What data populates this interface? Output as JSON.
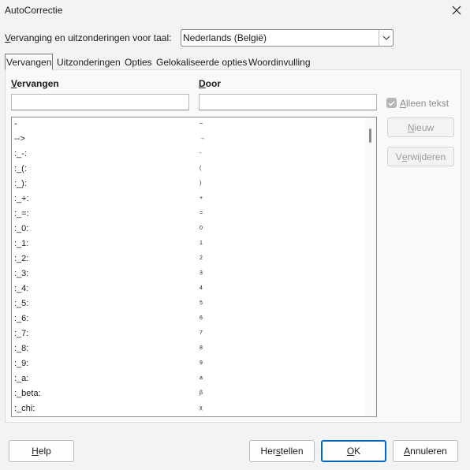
{
  "window": {
    "title": "AutoCorrectie"
  },
  "language": {
    "label_pre": "V",
    "label_rest": "ervanging en uitzonderingen voor taal:",
    "value": "Nederlands (België)"
  },
  "tabs": [
    {
      "label": "Vervangen",
      "active": true
    },
    {
      "label": "Uitzonderingen",
      "active": false
    },
    {
      "label": "Opties",
      "active": false
    },
    {
      "label": "Gelokaliseerde opties",
      "active": false
    },
    {
      "label": "Woordinvulling",
      "active": false
    }
  ],
  "replace": {
    "col1_pre": "V",
    "col1_rest": "ervangen",
    "col2_pre": "D",
    "col2_rest": "oor",
    "input1_value": "",
    "input2_value": "",
    "rows": [
      {
        "from": "-",
        "to": "–"
      },
      {
        "from": "-->",
        "to": "→"
      },
      {
        "from": ":_-:",
        "to": "-"
      },
      {
        "from": ":_(:",
        "to": "("
      },
      {
        "from": ":_):",
        "to": ")"
      },
      {
        "from": ":_+:",
        "to": "+"
      },
      {
        "from": ":_=:",
        "to": "="
      },
      {
        "from": ":_0:",
        "to": "0"
      },
      {
        "from": ":_1:",
        "to": "1"
      },
      {
        "from": ":_2:",
        "to": "2"
      },
      {
        "from": ":_3:",
        "to": "3"
      },
      {
        "from": ":_4:",
        "to": "4"
      },
      {
        "from": ":_5:",
        "to": "5"
      },
      {
        "from": ":_6:",
        "to": "6"
      },
      {
        "from": ":_7:",
        "to": "7"
      },
      {
        "from": ":_8:",
        "to": "8"
      },
      {
        "from": ":_9:",
        "to": "9"
      },
      {
        "from": ":_a:",
        "to": "a"
      },
      {
        "from": ":_beta:",
        "to": "β"
      },
      {
        "from": ":_chi:",
        "to": "χ"
      }
    ]
  },
  "side": {
    "checkbox_label_pre": "A",
    "checkbox_label_rest": "lleen tekst",
    "checkbox_checked": true,
    "new_pre": "N",
    "new_rest": "ieuw",
    "delete_pre": "V",
    "delete_mid": "e",
    "delete_rest": "rwijderen"
  },
  "buttons": {
    "help_pre": "",
    "help_u": "H",
    "help_rest": "elp",
    "reset_pre": "Her",
    "reset_u": "s",
    "reset_rest": "tellen",
    "ok_u": "O",
    "ok_rest": "K",
    "cancel_u": "A",
    "cancel_rest": "nnuleren"
  }
}
